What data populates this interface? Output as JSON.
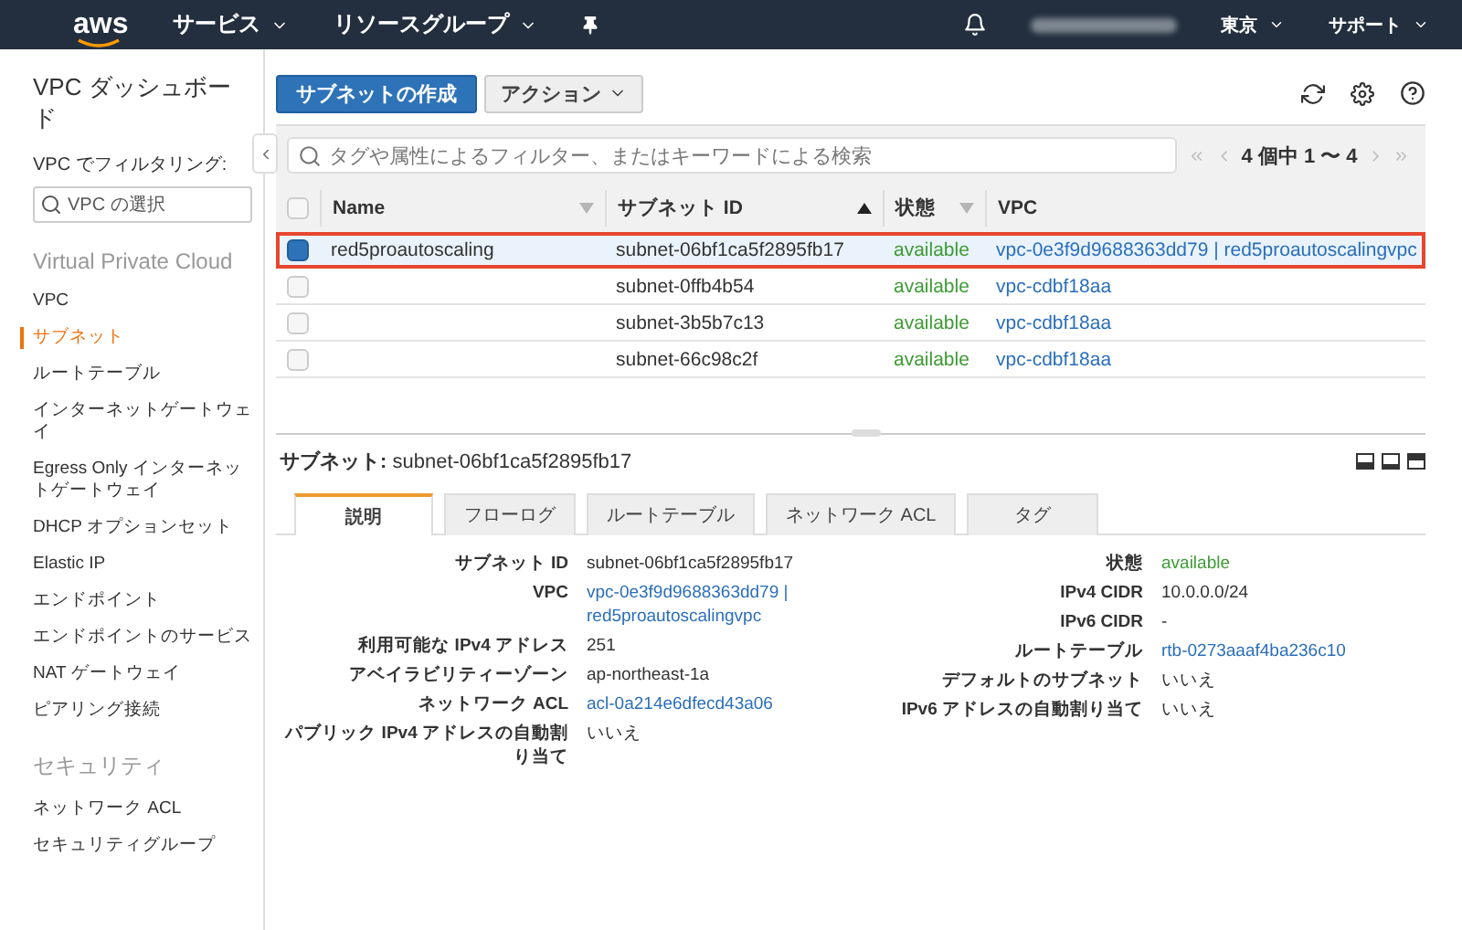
{
  "header": {
    "logo": "aws",
    "menus": [
      {
        "label": "サービス"
      },
      {
        "label": "リソースグループ"
      }
    ],
    "region": "東京",
    "support": "サポート"
  },
  "sidebar": {
    "title": "VPC ダッシュボード",
    "filter_label": "VPC でフィルタリング:",
    "filter_placeholder": "VPC の選択",
    "sections": [
      {
        "heading": "Virtual Private Cloud",
        "items": [
          {
            "label": "VPC",
            "selected": false
          },
          {
            "label": "サブネット",
            "selected": true
          },
          {
            "label": "ルートテーブル",
            "selected": false
          },
          {
            "label": "インターネットゲートウェイ",
            "selected": false
          },
          {
            "label": "Egress Only インターネットゲートウェイ",
            "selected": false
          },
          {
            "label": "DHCP オプションセット",
            "selected": false
          },
          {
            "label": "Elastic IP",
            "selected": false
          },
          {
            "label": "エンドポイント",
            "selected": false
          },
          {
            "label": "エンドポイントのサービス",
            "selected": false
          },
          {
            "label": "NAT ゲートウェイ",
            "selected": false
          },
          {
            "label": "ピアリング接続",
            "selected": false
          }
        ]
      },
      {
        "heading": "セキュリティ",
        "items": [
          {
            "label": "ネットワーク ACL",
            "selected": false
          },
          {
            "label": "セキュリティグループ",
            "selected": false
          }
        ]
      }
    ]
  },
  "toolbar": {
    "create_button": "サブネットの作成",
    "action_button": "アクション"
  },
  "filter": {
    "placeholder": "タグや属性によるフィルター、またはキーワードによる検索",
    "pagination": "4 個中 1 〜 4"
  },
  "table": {
    "all_selected": false,
    "columns": [
      {
        "label": "Name",
        "sortable": true,
        "sorted": false
      },
      {
        "label": "サブネット ID",
        "sortable": true,
        "sorted": true
      },
      {
        "label": "状態",
        "sortable": true,
        "sorted": false
      },
      {
        "label": "VPC",
        "sortable": false
      }
    ],
    "rows": [
      {
        "name": "red5proautoscaling",
        "subnet_id": "subnet-06bf1ca5f2895fb17",
        "state": "available",
        "vpc": "vpc-0e3f9d9688363dd79 | red5proautoscalingvpc",
        "selected": true
      },
      {
        "name": "",
        "subnet_id": "subnet-0ffb4b54",
        "state": "available",
        "vpc": "vpc-cdbf18aa",
        "selected": false
      },
      {
        "name": "",
        "subnet_id": "subnet-3b5b7c13",
        "state": "available",
        "vpc": "vpc-cdbf18aa",
        "selected": false
      },
      {
        "name": "",
        "subnet_id": "subnet-66c98c2f",
        "state": "available",
        "vpc": "vpc-cdbf18aa",
        "selected": false
      }
    ]
  },
  "details": {
    "title_label": "サブネット:",
    "title_value": "subnet-06bf1ca5f2895fb17",
    "tabs": [
      {
        "label": "説明",
        "selected": true
      },
      {
        "label": "フローログ",
        "selected": false
      },
      {
        "label": "ルートテーブル",
        "selected": false
      },
      {
        "label": "ネットワーク ACL",
        "selected": false
      },
      {
        "label": "タグ",
        "selected": false
      }
    ],
    "left": [
      {
        "label": "サブネット ID",
        "value": "subnet-06bf1ca5f2895fb17",
        "kind": "text"
      },
      {
        "label": "VPC",
        "value": "vpc-0e3f9d9688363dd79 | red5proautoscalingvpc",
        "kind": "link"
      },
      {
        "label": "利用可能な IPv4 アドレス",
        "value": "251",
        "kind": "text"
      },
      {
        "label": "アベイラビリティーゾーン",
        "value": "ap-northeast-1a",
        "kind": "text"
      },
      {
        "label": "ネットワーク ACL",
        "value": "acl-0a214e6dfecd43a06",
        "kind": "link"
      },
      {
        "label": "パブリック IPv4 アドレスの自動割り当て",
        "value": "いいえ",
        "kind": "text"
      }
    ],
    "right": [
      {
        "label": "状態",
        "value": "available",
        "kind": "status"
      },
      {
        "label": "IPv4 CIDR",
        "value": "10.0.0.0/24",
        "kind": "text"
      },
      {
        "label": "IPv6 CIDR",
        "value": "-",
        "kind": "text"
      },
      {
        "label": "ルートテーブル",
        "value": "rtb-0273aaaf4ba236c10",
        "kind": "link"
      },
      {
        "label": "デフォルトのサブネット",
        "value": "いいえ",
        "kind": "text"
      },
      {
        "label": "IPv6 アドレスの自動割り当て",
        "value": "いいえ",
        "kind": "text"
      }
    ]
  }
}
